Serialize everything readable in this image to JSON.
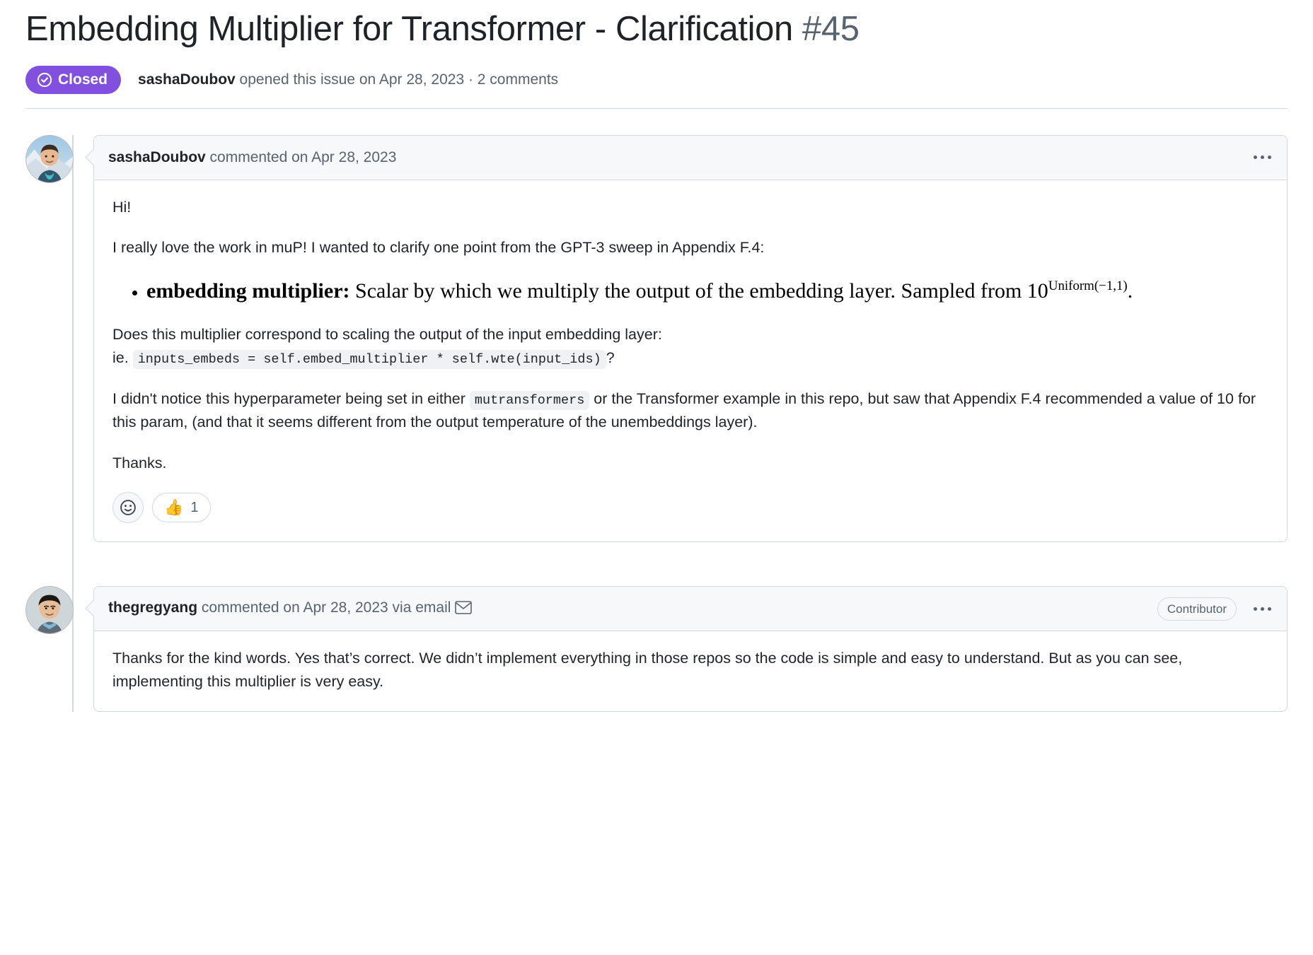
{
  "issue": {
    "title": "Embedding Multiplier for Transformer - Clarification",
    "number": "#45",
    "state_label": "Closed",
    "state_color": "#8250df",
    "meta_author": "sashaDoubov",
    "meta_rest": " opened this issue on Apr 28, 2023 · 2 comments"
  },
  "comments": [
    {
      "author": "sashaDoubov",
      "header_rest": " commented on Apr 28, 2023",
      "via_email": false,
      "badge": null,
      "menu_icon": "kebab-horizontal-icon",
      "avatar_alt": "sashaDoubov-avatar",
      "body": {
        "greeting": "Hi!",
        "intro": "I really love the work in muP! I wanted to clarify one point from the GPT-3 sweep in Appendix F.4:",
        "bullet_term": "embedding multiplier:",
        "bullet_text_1": " Scalar by which we multiply the output of the embedding layer. Sampled from 10",
        "bullet_superscript": "Uniform(−1,1)",
        "bullet_text_2": ".",
        "question_line": "Does this multiplier correspond to scaling the output of the input embedding layer:",
        "ie_prefix": "ie.",
        "code_snippet": "inputs_embeds = self.embed_multiplier * self.wte(input_ids)",
        "ie_suffix": "?",
        "para3_part1": "I didn't notice this hyperparameter being set in either ",
        "para3_code": "mutransformers",
        "para3_part2": " or the Transformer example in this repo, but saw that Appendix F.4 recommended a value of 10 for this param, (and that it seems different from the output temperature of the unembeddings layer).",
        "thanks": "Thanks."
      },
      "reactions": {
        "add_label": "smiley-add-reaction-icon",
        "items": [
          {
            "emoji": "👍",
            "count": "1",
            "name": "thumbs-up"
          }
        ]
      }
    },
    {
      "author": "thegregyang",
      "header_rest": " commented on Apr 28, 2023 via email",
      "via_email": true,
      "badge": "Contributor",
      "menu_icon": "kebab-horizontal-icon",
      "avatar_alt": "thegregyang-avatar",
      "body": {
        "para1": "Thanks for the kind words. Yes that’s correct. We didn’t implement everything in those repos so the code is simple and easy to understand. But as you can see, implementing this multiplier is very easy."
      }
    }
  ]
}
